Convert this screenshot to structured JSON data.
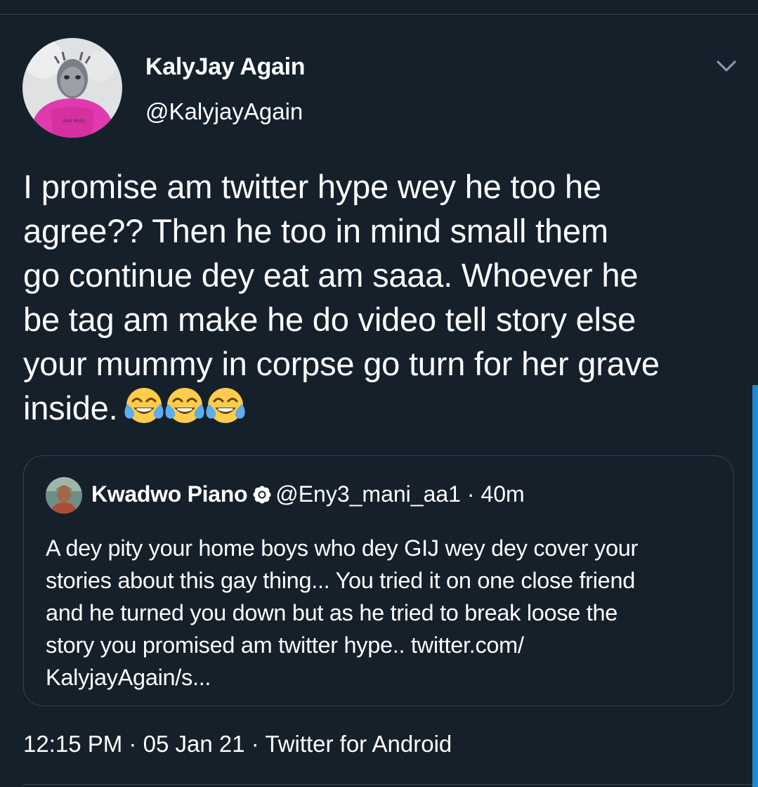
{
  "tweet": {
    "author": {
      "display_name": "KalyJay Again",
      "handle": "@KalyjayAgain",
      "avatar_icon": "user-avatar-pink-hoodie"
    },
    "menu_icon": "chevron-down-icon",
    "text_lines": [
      "I promise am twitter hype wey he too he",
      "agree?? Then he too in mind small them",
      "go continue dey eat am saaa. Whoever he",
      "be tag am make he do video tell story else",
      "your mummy in corpse go turn for her grave",
      "inside."
    ],
    "emojis": [
      "face-with-tears-of-joy",
      "face-with-tears-of-joy",
      "face-with-tears-of-joy"
    ],
    "quoted_tweet": {
      "display_name": "Kwadwo Piano",
      "badge_icon": "flower-icon",
      "handle": "@Eny3_mani_aa1",
      "time": "40m",
      "separator": "·",
      "text_lines": [
        "A dey pity your home boys who dey GIJ wey dey cover your",
        "stories about this gay thing...  You tried it on one close friend",
        "and he turned you down but as he tried to break  loose the",
        "story you promised am twitter hype.. twitter.com/",
        "KalyjayAgain/s..."
      ]
    },
    "meta": {
      "time": "12:15 PM",
      "date": "05 Jan 21",
      "source": "Twitter for Android",
      "separator": "·"
    }
  },
  "colors": {
    "background": "#15202b",
    "border": "#38444d",
    "text": "#ffffff",
    "accent": "#1d9bf0"
  }
}
